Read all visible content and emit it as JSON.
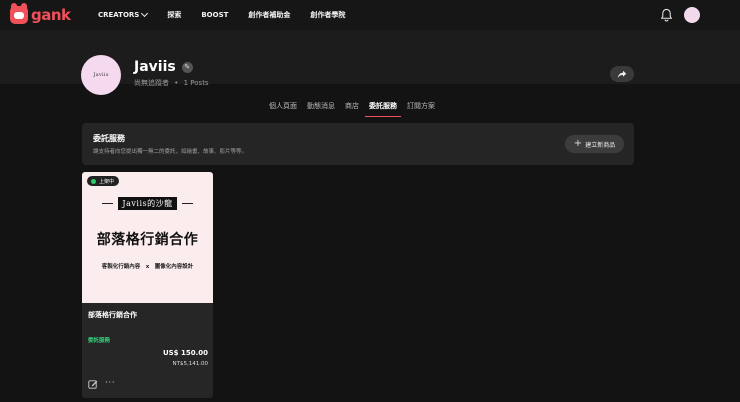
{
  "brand": {
    "name": "gank",
    "color": "#f0505a"
  },
  "nav": {
    "creators": "CREATORS",
    "explore": "探索",
    "boost": "BOOST",
    "creator_fund": "創作者補助金",
    "creator_academy": "創作者學院"
  },
  "profile": {
    "name": "Javiis",
    "avatar_text": "Javiis",
    "followers": "尚無追蹤者",
    "separator": "•",
    "posts": "1 Posts"
  },
  "tabs": [
    {
      "label": "個人頁面"
    },
    {
      "label": "動態消息"
    },
    {
      "label": "商店"
    },
    {
      "label": "委託服務",
      "active": true
    },
    {
      "label": "訂閱方案"
    }
  ],
  "section": {
    "title": "委託服務",
    "description": "讓支持者向您提出獨一無二的委託，如繪畫、故事、影片等等。",
    "create_label": "建立新商品"
  },
  "card": {
    "status": "上架中",
    "image_title": "Javiis的沙龍",
    "image_heading": "部落格行銷合作",
    "image_subtitle": "客製化行銷內容　x　圖像化內容設計",
    "name": "部落格行銷合作",
    "category": "委託服務",
    "price_usd": "US$ 150.00",
    "price_twd": "NT$5,141.00"
  }
}
